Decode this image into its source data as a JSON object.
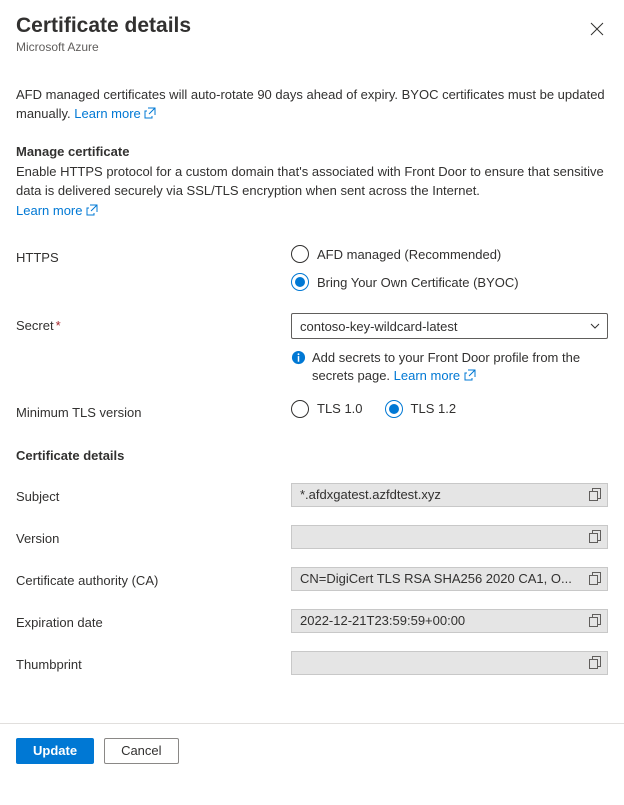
{
  "header": {
    "title": "Certificate details",
    "subtitle": "Microsoft Azure"
  },
  "description": {
    "text_prefix": "AFD managed certificates will auto-rotate 90 days ahead of expiry. BYOC certificates must be updated manually. ",
    "learn_more": "Learn more"
  },
  "manage": {
    "title": "Manage certificate",
    "desc": "Enable HTTPS protocol for a custom domain that's associated with Front Door to ensure that sensitive data is delivered securely via SSL/TLS encryption when sent across the Internet.",
    "learn_more": "Learn more"
  },
  "form": {
    "https_label": "HTTPS",
    "https_opt_managed": "AFD managed (Recommended)",
    "https_opt_byoc": "Bring Your Own Certificate (BYOC)",
    "secret_label": "Secret",
    "secret_value": "contoso-key-wildcard-latest",
    "secret_info_prefix": "Add secrets to your Front Door profile from the secrets page. ",
    "secret_info_link": "Learn more",
    "tls_label": "Minimum TLS version",
    "tls_opt_10": "TLS 1.0",
    "tls_opt_12": "TLS 1.2"
  },
  "details": {
    "title": "Certificate details",
    "rows": {
      "subject_label": "Subject",
      "subject_value": "*.afdxgatest.azfdtest.xyz",
      "version_label": "Version",
      "version_value": "",
      "ca_label": "Certificate authority (CA)",
      "ca_value": "CN=DigiCert TLS RSA SHA256 2020 CA1, O...",
      "expiry_label": "Expiration date",
      "expiry_value": "2022-12-21T23:59:59+00:00",
      "thumb_label": "Thumbprint",
      "thumb_value": ""
    }
  },
  "footer": {
    "update": "Update",
    "cancel": "Cancel"
  }
}
